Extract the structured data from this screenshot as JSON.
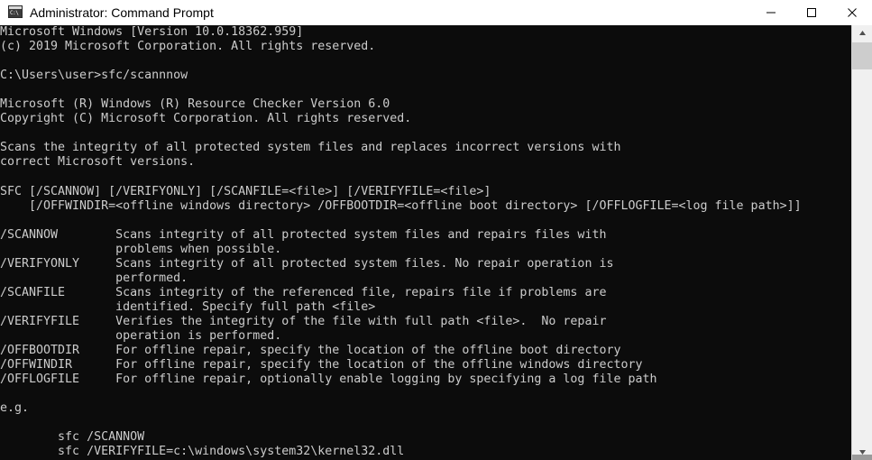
{
  "window": {
    "title": "Administrator: Command Prompt",
    "icon": "command-prompt-icon",
    "icon_glyph": "C:\\",
    "background_color": "#0c0c0c",
    "text_color": "#cccccc",
    "titlebar_color": "#ffffff",
    "controls": {
      "minimize": "minimize-icon",
      "maximize": "maximize-icon",
      "close": "close-icon"
    }
  },
  "scrollbar": {
    "up_arrow": "scroll-up-arrow-icon",
    "down_arrow": "scroll-down-arrow-icon",
    "thumb": "scrollbar-thumb",
    "position_percent": 4
  },
  "console": {
    "lines": [
      "Microsoft Windows [Version 10.0.18362.959]",
      "(c) 2019 Microsoft Corporation. All rights reserved.",
      "",
      "C:\\Users\\user>sfc/scannnow",
      "",
      "Microsoft (R) Windows (R) Resource Checker Version 6.0",
      "Copyright (C) Microsoft Corporation. All rights reserved.",
      "",
      "Scans the integrity of all protected system files and replaces incorrect versions with",
      "correct Microsoft versions.",
      "",
      "SFC [/SCANNOW] [/VERIFYONLY] [/SCANFILE=<file>] [/VERIFYFILE=<file>]",
      "    [/OFFWINDIR=<offline windows directory> /OFFBOOTDIR=<offline boot directory> [/OFFLOGFILE=<log file path>]]",
      "",
      "/SCANNOW        Scans integrity of all protected system files and repairs files with",
      "                problems when possible.",
      "/VERIFYONLY     Scans integrity of all protected system files. No repair operation is",
      "                performed.",
      "/SCANFILE       Scans integrity of the referenced file, repairs file if problems are",
      "                identified. Specify full path <file>",
      "/VERIFYFILE     Verifies the integrity of the file with full path <file>.  No repair",
      "                operation is performed.",
      "/OFFBOOTDIR     For offline repair, specify the location of the offline boot directory",
      "/OFFWINDIR      For offline repair, specify the location of the offline windows directory",
      "/OFFLOGFILE     For offline repair, optionally enable logging by specifying a log file path",
      "",
      "e.g.",
      "",
      "        sfc /SCANNOW",
      "        sfc /VERIFYFILE=c:\\windows\\system32\\kernel32.dll"
    ],
    "command_entered": "sfc/scannnow",
    "prompt_path": "C:\\Users\\user>",
    "os_version": "10.0.18362.959",
    "copyright_year": "2019",
    "tool_name": "Microsoft (R) Windows (R) Resource Checker",
    "tool_version": "6.0"
  }
}
